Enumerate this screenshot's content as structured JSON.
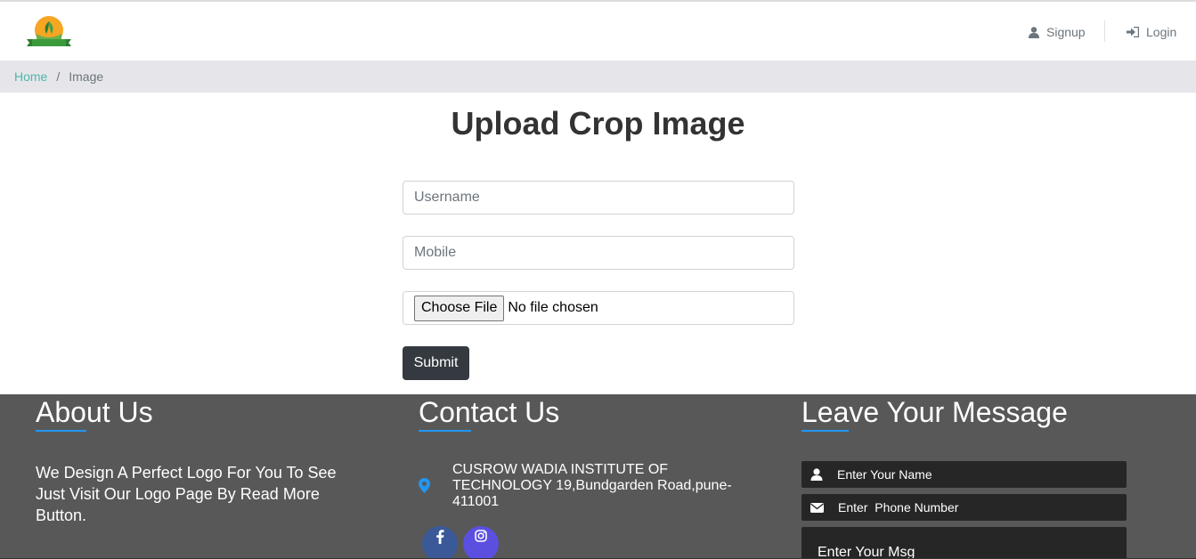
{
  "header": {
    "logo_icon": "farm-logo-icon",
    "logo_text": "",
    "nav": [
      {
        "label": "Signup",
        "icon": "user-icon"
      },
      {
        "label": "Login",
        "icon": "sign-in-icon"
      }
    ]
  },
  "breadcrumb": {
    "home": "Home",
    "separator": "/",
    "current": "Image"
  },
  "main": {
    "title": "Upload Crop Image",
    "username_placeholder": "Username",
    "mobile_placeholder": "Mobile",
    "file_button": "Choose File",
    "file_status": "No file chosen",
    "submit_label": "Submit"
  },
  "footer": {
    "about": {
      "heading": "About Us",
      "text": "We Design A Perfect Logo For You To See Just Visit Our Logo Page By Read More Button."
    },
    "contact": {
      "heading": "Contact Us",
      "address": "CUSROW WADIA INSTITUTE OF TECHNOLOGY 19,Bundgarden Road,pune-411001",
      "social": [
        {
          "icon": "facebook-icon",
          "color": "#3b5998"
        },
        {
          "icon": "instagram-icon",
          "color": "#5b4fe0"
        }
      ]
    },
    "message": {
      "heading": "Leave Your Message",
      "name_placeholder": "Enter Your Name",
      "phone_placeholder": "Enter  Phone Number",
      "msg_placeholder": "Enter Your Msg"
    }
  },
  "colors": {
    "accent": "#2196f3",
    "breadcrumb_link": "#4db6ac",
    "footer_bg": "#585858",
    "submit_bg": "#343a40"
  }
}
